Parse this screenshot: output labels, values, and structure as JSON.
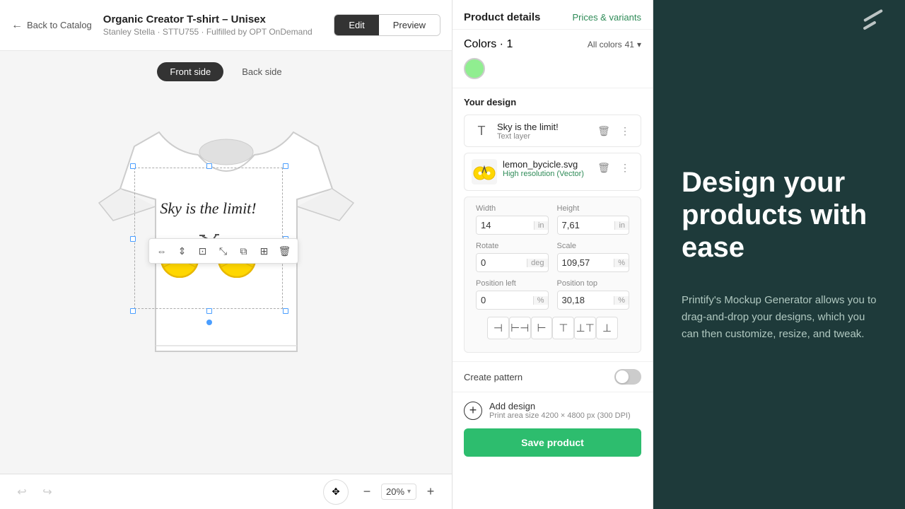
{
  "header": {
    "back_label": "Back to Catalog",
    "product_title": "Organic Creator T-shirt – Unisex",
    "product_subtitle": "Stanley Stella · STTU755 · Fulfilled by OPT OnDemand",
    "edit_label": "Edit",
    "preview_label": "Preview"
  },
  "canvas": {
    "front_side_label": "Front side",
    "back_side_label": "Back side",
    "design_text": "Sky is the limit!"
  },
  "toolbar": {
    "icons": [
      "⊟",
      "⊞",
      "⊡",
      "⊠",
      "⧉",
      "⧇",
      "🗑"
    ]
  },
  "bottom_bar": {
    "zoom_value": "20%"
  },
  "product_details": {
    "title": "Product details",
    "prices_variants_label": "Prices & variants",
    "colors_label": "Colors",
    "colors_count": "1",
    "all_colors_label": "All colors",
    "all_colors_count": "41",
    "your_design_label": "Your design",
    "text_layer_name": "Sky is the limit!",
    "text_layer_sub": "Text layer",
    "svg_name": "lemon_bycicle.svg",
    "svg_quality": "High resolution (Vector)",
    "width_label": "Width",
    "width_value": "14",
    "width_unit": "in",
    "height_label": "Height",
    "height_value": "7,61",
    "height_unit": "in",
    "rotate_label": "Rotate",
    "rotate_value": "0",
    "rotate_unit": "deg",
    "scale_label": "Scale",
    "scale_value": "109,57",
    "scale_unit": "%",
    "pos_left_label": "Position left",
    "pos_left_value": "0",
    "pos_left_unit": "%",
    "pos_top_label": "Position top",
    "pos_top_value": "30,18",
    "pos_top_unit": "%",
    "create_pattern_label": "Create pattern",
    "add_design_label": "Add design",
    "add_design_sub": "Print area size 4200 × 4800 px (300 DPI)",
    "save_product_label": "Save product"
  },
  "marketing": {
    "headline": "Design your products with ease",
    "body": "Printify's Mockup Generator allows you to drag-and-drop your designs, which you can then customize, resize, and tweak."
  }
}
